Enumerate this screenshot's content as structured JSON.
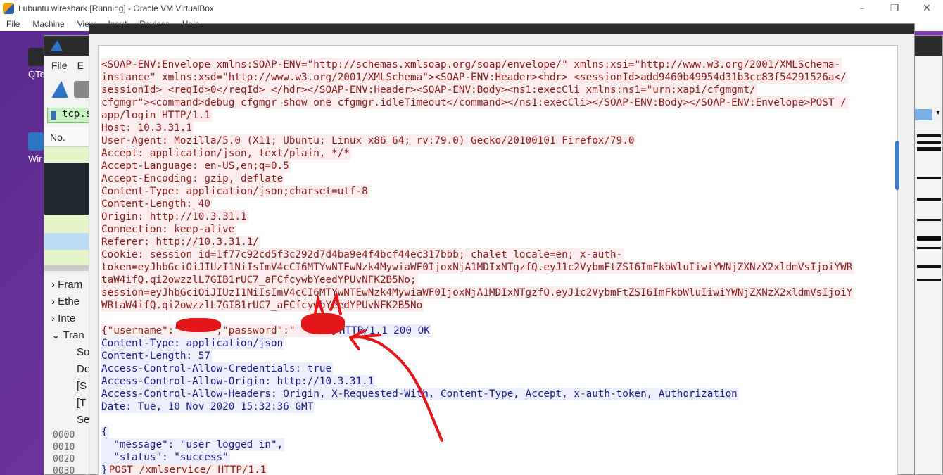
{
  "host": {
    "title": "Lubuntu wireshark [Running] - Oracle VM VirtualBox",
    "menu": [
      "File",
      "Machine",
      "View",
      "Input",
      "Devices",
      "Help"
    ]
  },
  "desktop": {
    "icons": [
      "QTe",
      "Wir"
    ]
  },
  "wireshark": {
    "menu": [
      "File",
      "E"
    ],
    "filter_value": "tcp.st",
    "col_no": "No.",
    "tree": [
      "Fram",
      "Ethe",
      "Inte",
      "Tran",
      "So",
      "De",
      "[S",
      "[T",
      "Se"
    ],
    "hex_offsets": [
      "0000",
      "0010",
      "0020",
      "0030"
    ]
  },
  "stream": {
    "lines": [
      {
        "who": "client",
        "text": "<SOAP-ENV:Envelope xmlns:SOAP-ENV=\"http://schemas.xmlsoap.org/soap/envelope/\" xmlns:xsi=\"http://www.w3.org/2001/XMLSchema-"
      },
      {
        "who": "client",
        "text": "instance\" xmlns:xsd=\"http://www.w3.org/2001/XMLSchema\"><SOAP-ENV:Header><hdr> <sessionId>add9460b49954d31b3cc83f54291526a</"
      },
      {
        "who": "client",
        "text": "sessionId> <reqId>0</reqId> </hdr></SOAP-ENV:Header><SOAP-ENV:Body><ns1:execCli xmlns:ns1=\"urn:xapi/cfgmgmt/"
      },
      {
        "who": "client",
        "text": "cfgmgr\"><command>debug cfgmgr show one cfgmgr.idleTimeout</command></ns1:execCli></SOAP-ENV:Body></SOAP-ENV:Envelope>POST /"
      },
      {
        "who": "client",
        "text": "app/login HTTP/1.1"
      },
      {
        "who": "client",
        "text": "Host: 10.3.31.1"
      },
      {
        "who": "client",
        "text": "User-Agent: Mozilla/5.0 (X11; Ubuntu; Linux x86_64; rv:79.0) Gecko/20100101 Firefox/79.0"
      },
      {
        "who": "client",
        "text": "Accept: application/json, text/plain, */*"
      },
      {
        "who": "client",
        "text": "Accept-Language: en-US,en;q=0.5"
      },
      {
        "who": "client",
        "text": "Accept-Encoding: gzip, deflate"
      },
      {
        "who": "client",
        "text": "Content-Type: application/json;charset=utf-8"
      },
      {
        "who": "client",
        "text": "Content-Length: 40"
      },
      {
        "who": "client",
        "text": "Origin: http://10.3.31.1"
      },
      {
        "who": "client",
        "text": "Connection: keep-alive"
      },
      {
        "who": "client",
        "text": "Referer: http://10.3.31.1/"
      },
      {
        "who": "client",
        "text": "Cookie: session_id=1f77c92cd5f3c292d7d4ba9e4f4bcf44ec317bbb; chalet_locale=en; x-auth-"
      },
      {
        "who": "client",
        "text": "token=eyJhbGciOiJIUzI1NiIsImV4cCI6MTYwNTEwNzk4MywiaWF0IjoxNjA1MDIxNTgzfQ.eyJ1c2VybmFtZSI6ImFkbWluIiwiYWNjZXNzX2xldmVsIjoiYWR"
      },
      {
        "who": "client",
        "text": "taW4ifQ.qi2owzzlL7GIB1rUC7_aFCfcywbYeedYPUvNFK2B5No;"
      },
      {
        "who": "client",
        "text": "session=eyJhbGciOiJIUzI1NiIsImV4cCI6MTYwNTEwNzk4MywiaWF0IjoxNjA1MDIxNTgzfQ.eyJ1c2VybmFtZSI6ImFkbWluIiwiYWNjZXNzX2xldmVsIjoiY"
      },
      {
        "who": "client",
        "text": "WRtaW4ifQ.qi2owzzlL7GIB1rUC7_aFCfcywbYeedYPUvNFK2B5No"
      },
      {
        "who": "blank",
        "text": ""
      },
      {
        "who": "mixed",
        "client": "{\"username\":\"     \",\"password\":\"     \"}",
        "server": "HTTP/1.1 200 OK"
      },
      {
        "who": "server",
        "text": "Content-Type: application/json"
      },
      {
        "who": "server",
        "text": "Content-Length: 57"
      },
      {
        "who": "server",
        "text": "Access-Control-Allow-Credentials: true"
      },
      {
        "who": "server",
        "text": "Access-Control-Allow-Origin: http://10.3.31.1"
      },
      {
        "who": "server",
        "text": "Access-Control-Allow-Headers: Origin, X-Requested-With, Content-Type, Accept, x-auth-token, Authorization"
      },
      {
        "who": "server",
        "text": "Date: Tue, 10 Nov 2020 15:32:36 GMT"
      },
      {
        "who": "blank",
        "text": ""
      },
      {
        "who": "server",
        "text": "{"
      },
      {
        "who": "server",
        "text": "  \"message\": \"user logged in\","
      },
      {
        "who": "server",
        "text": "  \"status\": \"success\""
      },
      {
        "who": "mixed2",
        "server": "}",
        "client": "POST /xmlservice/ HTTP/1.1"
      }
    ]
  },
  "colors": {
    "client_bg": "#fbedee",
    "client_fg": "#8b1a1a",
    "server_bg": "#edeefb",
    "server_fg": "#1a1a8b",
    "annotation": "#e3171a"
  }
}
